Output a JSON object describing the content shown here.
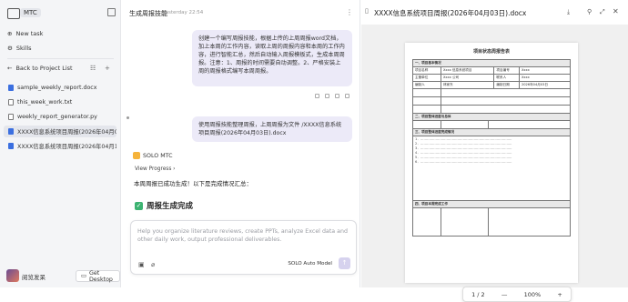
{
  "sidebar": {
    "brand": "MTC",
    "nav": [
      {
        "label": "New task",
        "icon": "plus-circle-icon"
      },
      {
        "label": "Skills",
        "icon": "skills-icon"
      }
    ],
    "back_label": "Back to Project List",
    "files": [
      {
        "name": "sample_weekly_report.docx",
        "icon": "blue"
      },
      {
        "name": "this_week_work.txt",
        "icon": "gray"
      },
      {
        "name": "weekly_report_generator.py",
        "icon": "gray"
      },
      {
        "name": "XXXX信息系统项目周报(2026年04月03...",
        "icon": "blue"
      },
      {
        "name": "XXXX信息系统项目周报(2026年04月10...",
        "icon": "blue"
      }
    ],
    "user_name": "阅览发呆",
    "get_desktop": "Get Desktop"
  },
  "chat": {
    "title": "生成周报技能",
    "time": "Yesterday 22:54",
    "msg1": "创建一个编写周报技能，根据上传的上周周报word文档，加上本周的工作内容，读取上周的周报内容和本周的工作内容，进行智能汇总，然后自动输入周报模板式，生成本周周报。注意：1、周报的时间需要自动调整。2、严格安装上周的周报格式编写本周周报。",
    "msg2": "使用周报技能整理周报，上周周报为文件 /XXXX信息系统项目周报(2026年04月03日).docx",
    "solo_name": "SOLO MTC",
    "view_progress": "View Progress",
    "reply": "本周周报已成功生成！以下是完成情况汇总：",
    "done_title": "周报生成完成",
    "placeholder": "Help you organize literature reviews, create PPTs, analyze Excel data and other daily work, output professional deliverables.",
    "model": "SOLO Auto Model"
  },
  "preview": {
    "title": "XXXX信息系统项目周报(2026年04月03日).docx",
    "page_heading": "项目状态周报告表",
    "section1": "一、项目基本情况",
    "labels": {
      "name": "项目名称",
      "name_val": "Xxxx 信息系统项目",
      "code": "项目编号",
      "code_val": "Xxxx",
      "owner": "主管单位",
      "owner_val": "Xxxx 公司",
      "contact": "联系人",
      "contact_val": "Xxxx",
      "author": "编制人",
      "author_val": "林家东",
      "date": "编制日期",
      "date_val": "2026年04月03日"
    },
    "section2": "二、项目整体进度与总体",
    "section3": "三、项目整体进度完成情况",
    "section4": "四、项目本周完成工作",
    "page_indicator": "1 / 2",
    "zoom": "100%"
  }
}
